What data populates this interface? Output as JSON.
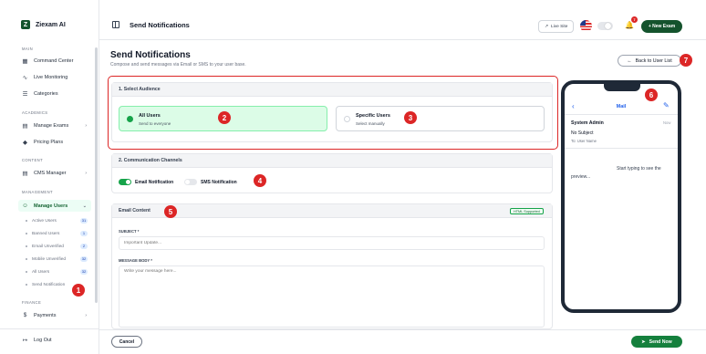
{
  "sidebar": {
    "brand": "Ziexam AI",
    "brand_logo": "Z",
    "sections": {
      "main": "MAIN",
      "academics": "ACADEMICS",
      "content": "CONTENT",
      "management": "MANAGEMENT",
      "finance": "FINANCE"
    },
    "items": {
      "command_center": {
        "label": "Command Center",
        "icon": "grid-icon"
      },
      "live_monitoring": {
        "label": "Live Monitoring",
        "icon": "activity-icon"
      },
      "categories": {
        "label": "Categories",
        "icon": "list-icon"
      },
      "manage_exams": {
        "label": "Manage Exams",
        "icon": "file-icon"
      },
      "pricing_plans": {
        "label": "Pricing Plans",
        "icon": "tag-icon"
      },
      "cms_manager": {
        "label": "CMS Manager",
        "icon": "document-icon"
      },
      "manage_users": {
        "label": "Manage Users",
        "icon": "users-icon"
      },
      "payments": {
        "label": "Payments",
        "icon": "dollar-icon"
      },
      "logout": {
        "label": "Log Out",
        "icon": "logout-icon"
      }
    },
    "sub_items": [
      {
        "label": "Active Users",
        "count": "31"
      },
      {
        "label": "Banned Users",
        "count": "1"
      },
      {
        "label": "Email Unverified",
        "count": "2"
      },
      {
        "label": "Mobile Unverified",
        "count": "32"
      },
      {
        "label": "All Users",
        "count": "32"
      },
      {
        "label": "Send Notification",
        "count": ""
      }
    ]
  },
  "header": {
    "title": "Send Notifications",
    "live_site": "Live Site",
    "notification_count": "7",
    "new_exam": "+ New Exam"
  },
  "page": {
    "title": "Send Notifications",
    "subtitle": "Compose and send messages via Email or SMS to your user base.",
    "back_button": "Back to User List"
  },
  "audience": {
    "heading": "1. Select Audience",
    "all_users": {
      "title": "All Users",
      "subtitle": "Send to everyone",
      "selected": true
    },
    "specific_users": {
      "title": "Specific Users",
      "subtitle": "Select manually",
      "selected": false
    }
  },
  "channels": {
    "heading": "2. Communication Channels",
    "email": {
      "label": "Email Notification",
      "enabled": true
    },
    "sms": {
      "label": "SMS Notification",
      "enabled": false
    }
  },
  "email_content": {
    "heading": "Email Content",
    "badge": "HTML Supported",
    "subject_label": "SUBJECT *",
    "subject_placeholder": "Important Update...",
    "body_label": "MESSAGE BODY *",
    "body_placeholder": "Write your message here..."
  },
  "footer": {
    "cancel": "Cancel",
    "send": "Send Now"
  },
  "preview": {
    "app_title": "Mail",
    "from": "System Admin",
    "time": "Now",
    "subject": "No Subject",
    "to": "To: User Name",
    "body": "Start typing to see the preview..."
  },
  "markers": [
    "1",
    "2",
    "3",
    "4",
    "5",
    "6",
    "7"
  ],
  "colors": {
    "brand": "#14532d",
    "accent": "#16a34a",
    "annotation": "#dc2626",
    "preview_link": "#2563eb"
  }
}
